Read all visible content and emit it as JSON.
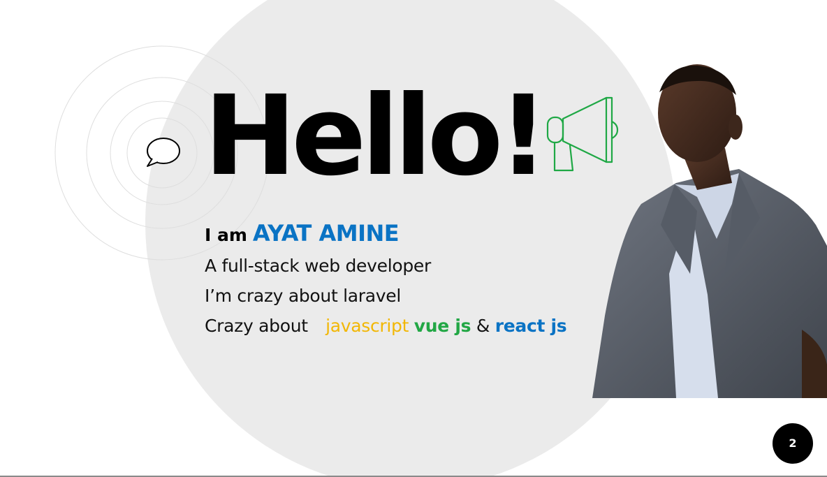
{
  "slide": {
    "hello": "Hello!",
    "intro": {
      "iam": "I am",
      "name": "AYAT AMINE",
      "line1": "A full-stack web developer",
      "line2": "I’m crazy about laravel",
      "line3_prefix": "Crazy about",
      "kw_javascript": "javascript",
      "kw_vue": "vue js",
      "amp": "&",
      "kw_react": "react js"
    },
    "page_number": "2"
  },
  "icons": {
    "bubble": "speech-bubble-icon",
    "megaphone": "megaphone-icon"
  },
  "colors": {
    "accent_blue": "#0a73c4",
    "javascript_yellow": "#f2b705",
    "vue_green": "#22a745",
    "react_blue": "#0a73c4",
    "megaphone_green": "#1fa845",
    "background_circle": "#ebebeb"
  }
}
